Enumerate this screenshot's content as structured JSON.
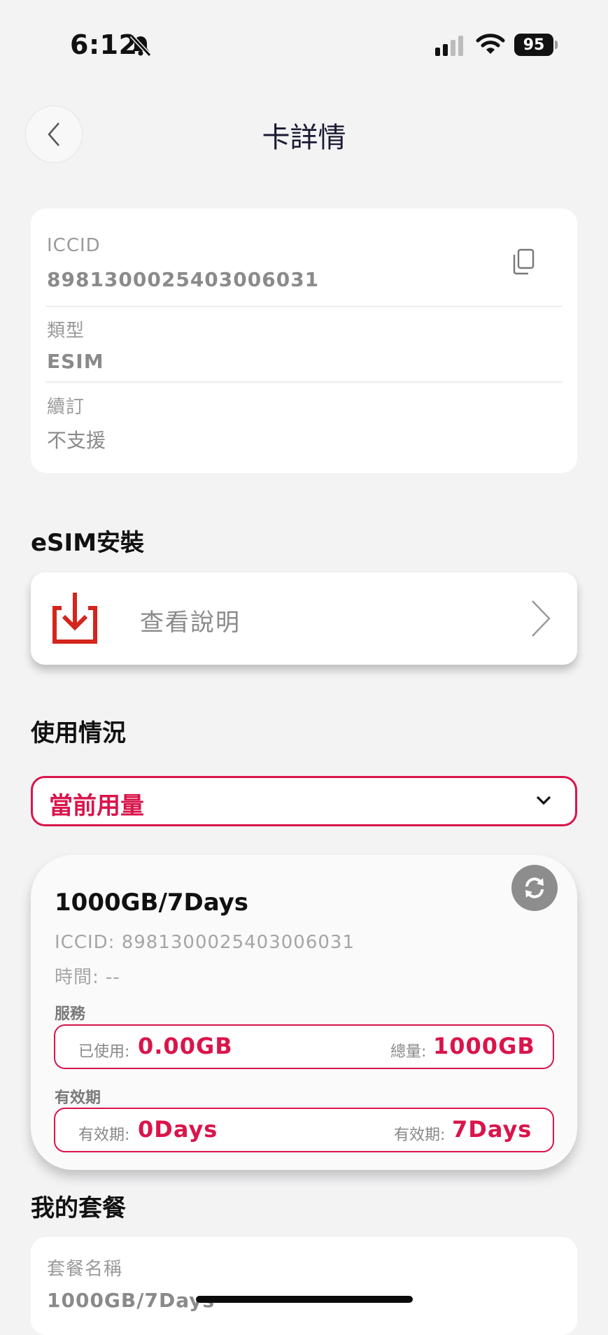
{
  "status_bar": {
    "time": "6:12",
    "battery": "95"
  },
  "header": {
    "title": "卡詳情"
  },
  "card_info": {
    "iccid_label": "ICCID",
    "iccid_value": "8981300025403006031",
    "type_label": "類型",
    "type_value": "ESIM",
    "renew_label": "續訂",
    "renew_value": "不支援"
  },
  "esim_section": {
    "title": "eSIM安裝",
    "action_label": "查看說明"
  },
  "usage_section": {
    "title": "使用情況",
    "selected_option": "當前用量"
  },
  "usage_card": {
    "plan_name": "1000GB/7Days",
    "iccid_line": "ICCID: 8981300025403006031",
    "time_line": "時間: --",
    "service_label": "服務",
    "used_label": "已使用:",
    "used_value": "0.00GB",
    "total_label": "總量:",
    "total_value": "1000GB",
    "validity_label": "有效期",
    "validity_used_label": "有效期:",
    "validity_used_value": "0Days",
    "validity_total_label": "有效期:",
    "validity_total_value": "7Days"
  },
  "my_package": {
    "title": "我的套餐",
    "name_label": "套餐名稱",
    "name_value": "1000GB/7Days"
  },
  "colors": {
    "accent": "#d9154b",
    "background": "#f3f3f4",
    "icon_red": "#d4261c"
  }
}
